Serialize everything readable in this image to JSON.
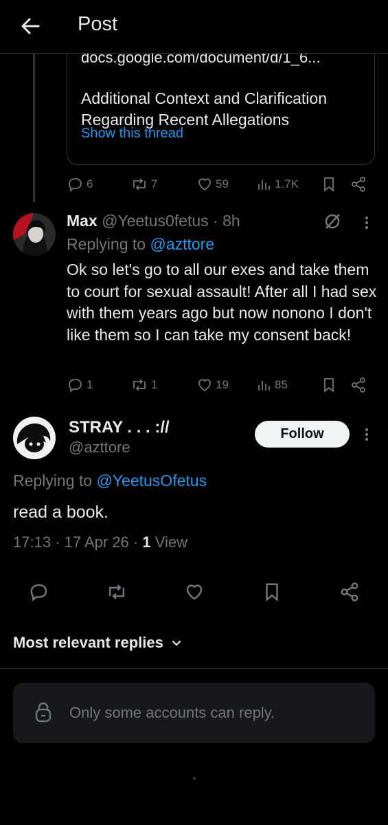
{
  "header": {
    "title": "Post"
  },
  "quoted_card": {
    "url": "docs.google.com/document/d/1_6...",
    "title": "Additional Context and Clarification Regarding Recent Allegations",
    "show_thread": "Show this thread"
  },
  "tweet1_actions": {
    "replies": "6",
    "reposts": "7",
    "likes": "59",
    "views": "1.7K"
  },
  "tweet2": {
    "name": "Max",
    "handle": "@Yeetus0fetus",
    "time": "· 8h",
    "replying_label": "Replying to",
    "replying_handle": "@azttore",
    "body": "Ok so let's go to all our exes and take them to court for sexual assault! After all I had sex with them years ago but now nonono I don't like them so I can take my consent back!",
    "actions": {
      "replies": "1",
      "reposts": "1",
      "likes": "19",
      "views": "85"
    }
  },
  "main_tweet": {
    "name": "STRAY . . . ://",
    "handle": "@azttore",
    "follow_label": "Follow",
    "replying_label": "Replying to",
    "replying_handle": "@YeetusOfetus",
    "body": "read a book.",
    "timestamp": "17:13 · 17 Apr 26 · ",
    "view_count": "1",
    "view_label": " View"
  },
  "sort": {
    "label": "Most relevant replies"
  },
  "reply_restriction": {
    "text": "Only some accounts can reply."
  },
  "colors": {
    "background": "#000000",
    "accent": "#1d9bf0",
    "muted": "#71767b",
    "text": "#e7e9ea"
  }
}
